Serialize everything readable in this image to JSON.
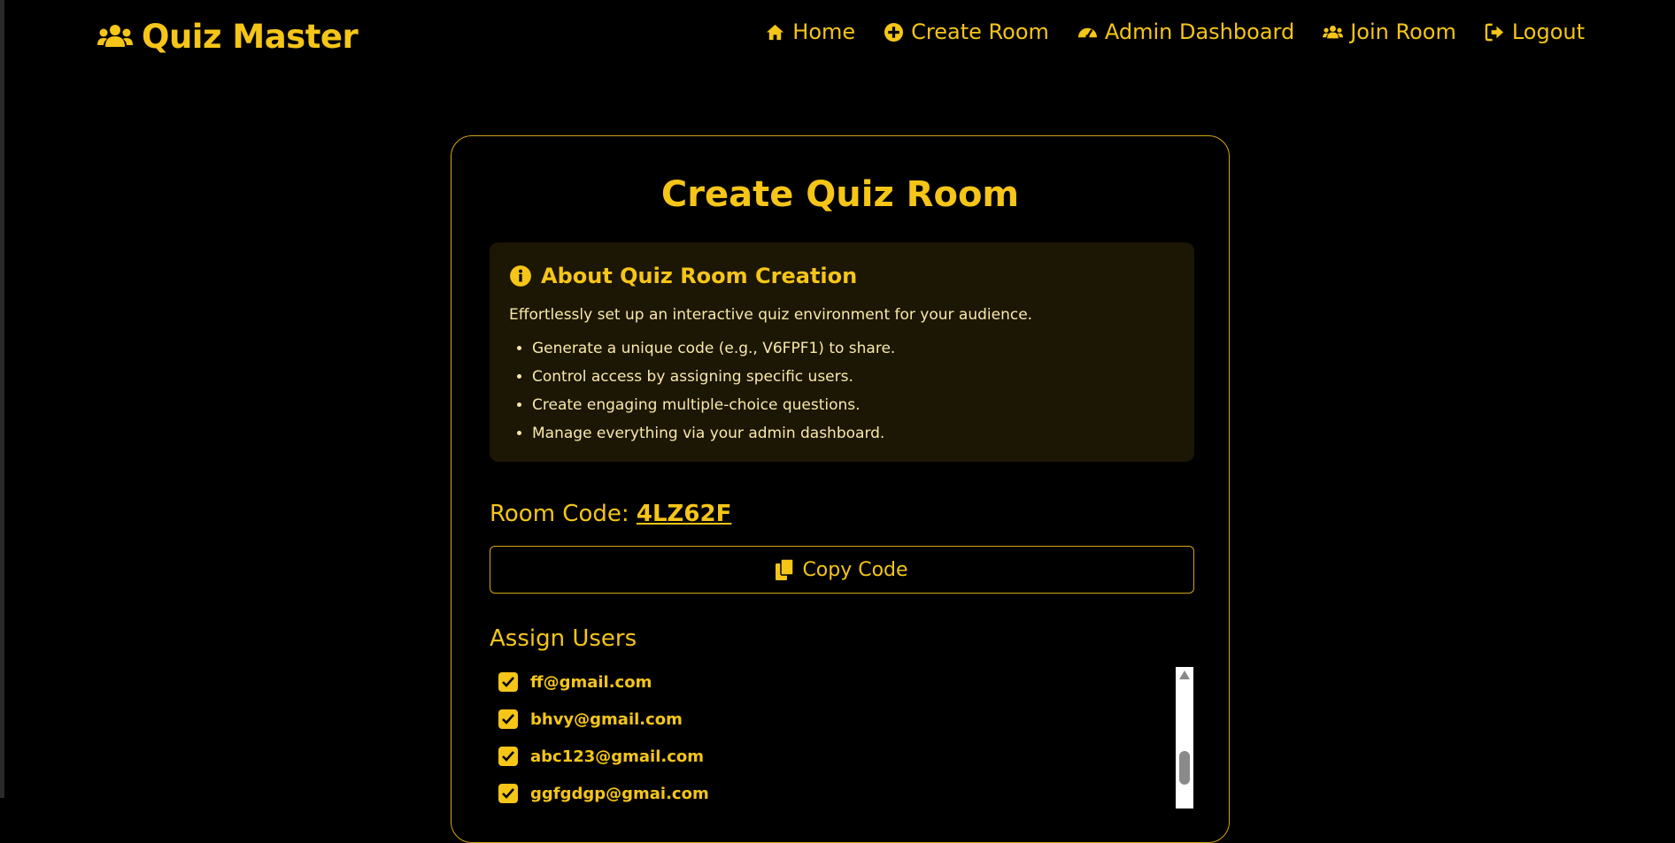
{
  "brand": {
    "name": "Quiz Master",
    "icon": "users-icon"
  },
  "nav": {
    "items": [
      {
        "label": "Home",
        "icon": "home-icon"
      },
      {
        "label": "Create Room",
        "icon": "plus-circle-icon"
      },
      {
        "label": "Admin Dashboard",
        "icon": "gauge-icon"
      },
      {
        "label": "Join Room",
        "icon": "users-icon"
      },
      {
        "label": "Logout",
        "icon": "logout-icon"
      }
    ]
  },
  "page": {
    "title": "Create Quiz Room"
  },
  "about": {
    "heading": "About Quiz Room Creation",
    "icon": "info-icon",
    "description": "Effortlessly set up an interactive quiz environment for your audience.",
    "bullets": [
      "Generate a unique code (e.g., V6FPF1) to share.",
      "Control access by assigning specific users.",
      "Create engaging multiple-choice questions.",
      "Manage everything via your admin dashboard."
    ]
  },
  "room": {
    "label": "Room Code:",
    "code": "4LZ62F"
  },
  "copy": {
    "label": "Copy Code",
    "icon": "copy-icon"
  },
  "assign": {
    "heading": "Assign Users",
    "users": [
      {
        "email": "ff@gmail.com",
        "checked": true
      },
      {
        "email": "bhvy@gmail.com",
        "checked": true
      },
      {
        "email": "abc123@gmail.com",
        "checked": true
      },
      {
        "email": "ggfgdgp@gmai.com",
        "checked": true
      }
    ]
  },
  "colors": {
    "accent": "#f5c518",
    "background": "#000000",
    "panel": "#1c1605"
  }
}
